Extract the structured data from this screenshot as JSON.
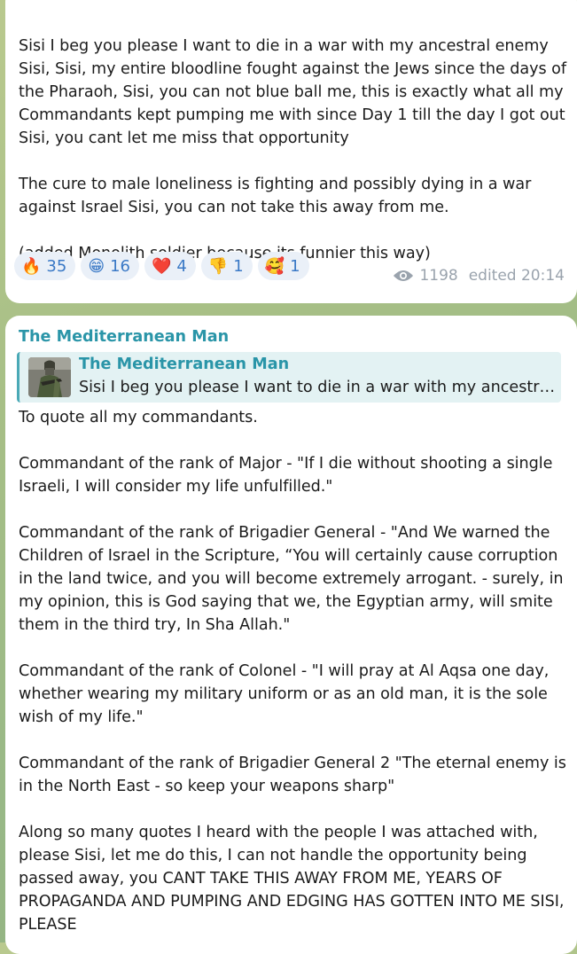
{
  "message1": {
    "text": "Sisi I beg you please I want to die in a war with my ancestral enemy Sisi, Sisi, my entire bloodline fought against the Jews since the days of the Pharaoh, Sisi, you can not blue ball me, this is exactly what all my Commandants kept pumping me with since Day 1 till the day I got out Sisi, you cant let me miss that opportunity\n\nThe cure to male loneliness is fighting and possibly dying in a war against Israel Sisi, you can not take this away from me.\n\n(added Monolith soldier because its funnier this way)",
    "reactions": [
      {
        "emoji": "🔥",
        "count": "35"
      },
      {
        "emoji": "😁",
        "count": "16"
      },
      {
        "emoji": "❤️",
        "count": "4"
      },
      {
        "emoji": "👎",
        "count": "1"
      },
      {
        "emoji": "🥰",
        "count": "1"
      }
    ],
    "views": "1198",
    "edited": "edited 20:14"
  },
  "message2": {
    "sender": "The Mediterranean Man",
    "reply": {
      "name": "The Mediterranean Man",
      "text": "Sisi I beg you please I want to die in a war with my ancestral enemy Sisi, Sisi, my entire bloodline fought against the Jews"
    },
    "text": "To quote all my commandants.\n\nCommandant of the rank of Major - \"If I die without shooting a single Israeli, I will consider my life unfulfilled.\"\n\nCommandant of the rank of Brigadier General - \"And We warned the Children of Israel in the Scripture, “You will certainly cause corruption in the land twice, and you will become extremely arrogant. - surely, in my opinion, this is God saying that we, the Egyptian army, will smite them in the third try, In Sha Allah.\"\n\nCommandant of the rank of Colonel - \"I will pray at Al Aqsa one day, whether wearing my military uniform or as an old man, it is the sole wish of my life.\"\n\nCommandant of the rank of Brigadier General 2 \"The eternal enemy is in the North East - so keep your weapons sharp\"\n\nAlong so many quotes I heard with the people I was attached with, please Sisi, let me do this, I can not handle the opportunity being passed away, you CANT TAKE THIS AWAY FROM ME, YEARS OF PROPAGANDA AND PUMPING AND EDGING HAS GOTTEN INTO ME SISI, PLEASE"
  },
  "colors": {
    "accent": "#2a95a8",
    "reaction_count": "#3a79c6",
    "meta": "#9aa3ad"
  }
}
